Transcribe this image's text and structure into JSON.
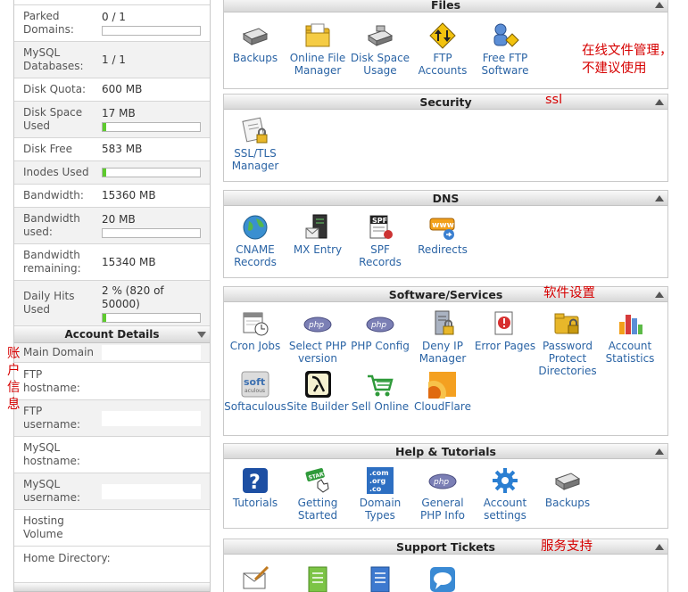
{
  "stats": {
    "parked_domains": {
      "label": "Parked Domains:",
      "value": "0 / 1",
      "usage_fraction": 0.0
    },
    "mysql_databases": {
      "label": "MySQL Databases:",
      "value": "1 / 1"
    },
    "disk_quota": {
      "label": "Disk Quota:",
      "value": "600 MB"
    },
    "disk_space_used": {
      "label": "Disk Space Used",
      "value": "17 MB",
      "usage_fraction": 0.03
    },
    "disk_free": {
      "label": "Disk Free",
      "value": "583 MB"
    },
    "inodes_used": {
      "label": "Inodes Used",
      "value": "",
      "usage_fraction": 0.03
    },
    "bandwidth": {
      "label": "Bandwidth:",
      "value": "15360 MB"
    },
    "bandwidth_used": {
      "label": "Bandwidth used:",
      "value": "20 MB",
      "usage_fraction": 0.0
    },
    "bandwidth_remaining": {
      "label": "Bandwidth remaining:",
      "value": "15340 MB"
    },
    "daily_hits": {
      "label": "Daily Hits Used",
      "value": "2 % (820 of 50000)",
      "usage_fraction": 0.02
    }
  },
  "account_details": {
    "title": "Account Details",
    "main_domain": {
      "label": "Main Domain"
    },
    "ftp_hostname": {
      "label": "FTP hostname:"
    },
    "ftp_username": {
      "label": "FTP username:"
    },
    "mysql_hostname": {
      "label": "MySQL hostname:"
    },
    "mysql_username": {
      "label": "MySQL username:"
    },
    "hosting_volume": {
      "label": "Hosting Volume"
    },
    "home_directory": {
      "label": "Home Directory:"
    }
  },
  "panels": {
    "files": {
      "title": "Files",
      "items": [
        "Backups",
        "Online File Manager",
        "Disk Space Usage",
        "FTP Accounts",
        "Free FTP Software"
      ]
    },
    "security": {
      "title": "Security",
      "items": [
        "SSL/TLS Manager"
      ]
    },
    "dns": {
      "title": "DNS",
      "items": [
        "CNAME Records",
        "MX Entry",
        "SPF Records",
        "Redirects"
      ]
    },
    "software": {
      "title": "Software/Services",
      "items": [
        "Cron Jobs",
        "Select PHP version",
        "PHP Config",
        "Deny IP Manager",
        "Error Pages",
        "Password Protect Directories",
        "Account Statistics",
        "Softaculous",
        "Site Builder",
        "Sell Online",
        "CloudFlare"
      ]
    },
    "help": {
      "title": "Help & Tutorials",
      "items": [
        "Tutorials",
        "Getting Started",
        "Domain Types",
        "General PHP Info",
        "Account settings",
        "Backups"
      ]
    },
    "support": {
      "title": "Support Tickets"
    }
  },
  "icon_text": {
    "php": "php",
    "spf": "SPF",
    "www": "www",
    "start": "START",
    "soft": "soft",
    "soft_sub": "aculous",
    "question": "?",
    "com": ".com",
    "org": ".org",
    "co": ".co"
  },
  "annotations": {
    "files_note_1": "在线文件管理，",
    "files_note_2": "不建议使用",
    "security_note": "ssl",
    "software_note": "软件设置",
    "account_note": "账户信息",
    "support_note": "服务支持"
  },
  "colors": {
    "link": "#2b64a5",
    "annotation": "#d60000",
    "bar_fill": "#5ecb2e"
  }
}
